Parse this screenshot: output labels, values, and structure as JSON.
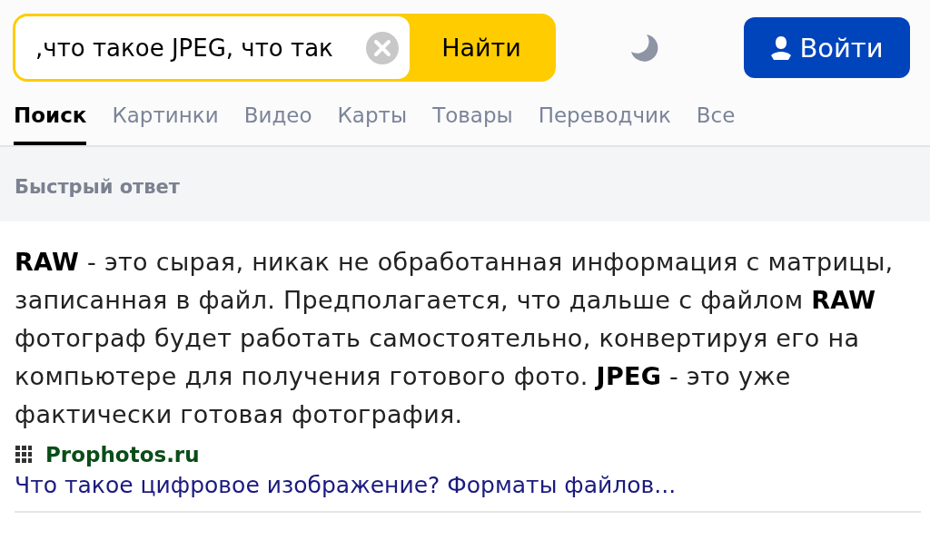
{
  "search": {
    "value": ",что такое JPEG, что так",
    "button": "Найти"
  },
  "login_button": "Войти",
  "tabs": [
    {
      "label": "Поиск",
      "selected": true
    },
    {
      "label": "Картинки",
      "selected": false
    },
    {
      "label": "Видео",
      "selected": false
    },
    {
      "label": "Карты",
      "selected": false
    },
    {
      "label": "Товары",
      "selected": false
    },
    {
      "label": "Переводчик",
      "selected": false
    },
    {
      "label": "Все",
      "selected": false
    }
  ],
  "quick_answer": {
    "heading": "Быстрый ответ",
    "text": "**RAW** - это сырая, никак не обработанная информация с матрицы, записанная в файл. Предполагается, что дальше с файлом **RAW** фотограф будет работать самостоятельно, конвертируя его на компьютере для получения готового фото. **JPEG** - это уже фактически готовая фотография.",
    "source": "Prophotos.ru",
    "link": "Что такое цифровое изображение? Форматы файлов..."
  }
}
